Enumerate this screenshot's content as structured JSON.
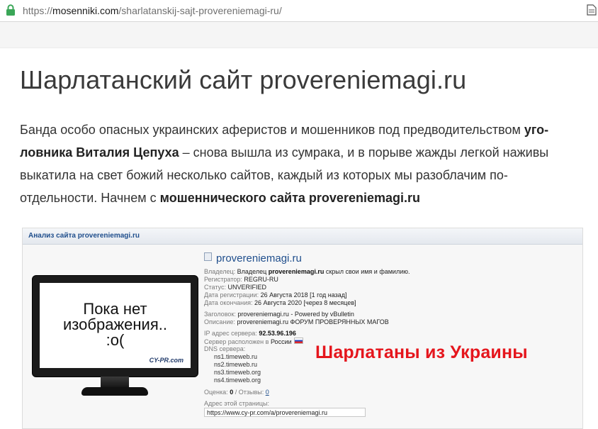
{
  "browser": {
    "url_prefix": "https://",
    "url_host": "mosenniki.com",
    "url_path": "/sharlatanskij-sajt-provereniemagi-ru/"
  },
  "article": {
    "title": "Шарлатанский сайт provereniemagi.ru",
    "paragraph": {
      "line1_text": "Банда особо опасных украинских аферистов и мошенников под предводительством ",
      "line1_bold": "уго-",
      "line2_bold": "ловника Виталия Цепуха",
      "line2_text": " – снова вышла из сумрака, и в порыве жажды легкой наживы",
      "line3_text": "выкатила на свет божий несколько сайтов, каждый из которых мы разоблачим по-",
      "line4_text": "отдельности. Начнем с ",
      "line4_bold": "мошеннического сайта provereniemagi.ru"
    }
  },
  "screenshot": {
    "header": "Анализ сайта provereniemagi.ru",
    "monitor": {
      "line1": "Пока нет",
      "line2": "изображения..",
      "line3": ":o(",
      "logo": "CY-PR.com"
    },
    "site_name": "provereniemagi.ru",
    "owner_label": "Владелец:",
    "owner_pre": "Владелец ",
    "owner_bold": "provereniemagi.ru",
    "owner_post": " скрыл свои имя и фамилию.",
    "registrar_label": "Регистратор:",
    "registrar": "REGRU-RU",
    "status_label": "Статус:",
    "status": "UNVERIFIED",
    "reg_date_label": "Дата регистрации:",
    "reg_date": "26 Августа 2018 [1 год назад]",
    "end_date_label": "Дата окончания:",
    "end_date": "26 Августа 2020 [через 8 месяцев]",
    "heading_label": "Заголовок:",
    "heading": "provereniemagi.ru - Powered by vBulletin",
    "desc_label": "Описание:",
    "desc": "provereniemagi.ru ФОРУМ ПРОВЕРЯННЫХ МАГОВ",
    "ip_label": "IP адрес сервера:",
    "ip": "92.53.96.196",
    "location_label": "Сервер расположен в",
    "location": "России",
    "dns_label": "DNS сервера:",
    "dns": [
      "ns1.timeweb.ru",
      "ns2.timeweb.ru",
      "ns3.timeweb.org",
      "ns4.timeweb.org"
    ],
    "rating_label": "Оценка:",
    "rating": "0",
    "rating_sep": "/ Отзывы:",
    "reviews": "0",
    "page_addr_label": "Адрес этой страницы:",
    "page_addr": "https://www.cy-pr.com/a/provereniemagi.ru",
    "stamp": "Шарлатаны из Украины"
  },
  "colors": {
    "lock_green": "#3aa657",
    "stamp_red": "#e5161d",
    "link_blue": "#1f4e8c"
  },
  "icons": [
    "lock-icon",
    "page-icon",
    "site-favicon-icon",
    "russia-flag-icon"
  ]
}
